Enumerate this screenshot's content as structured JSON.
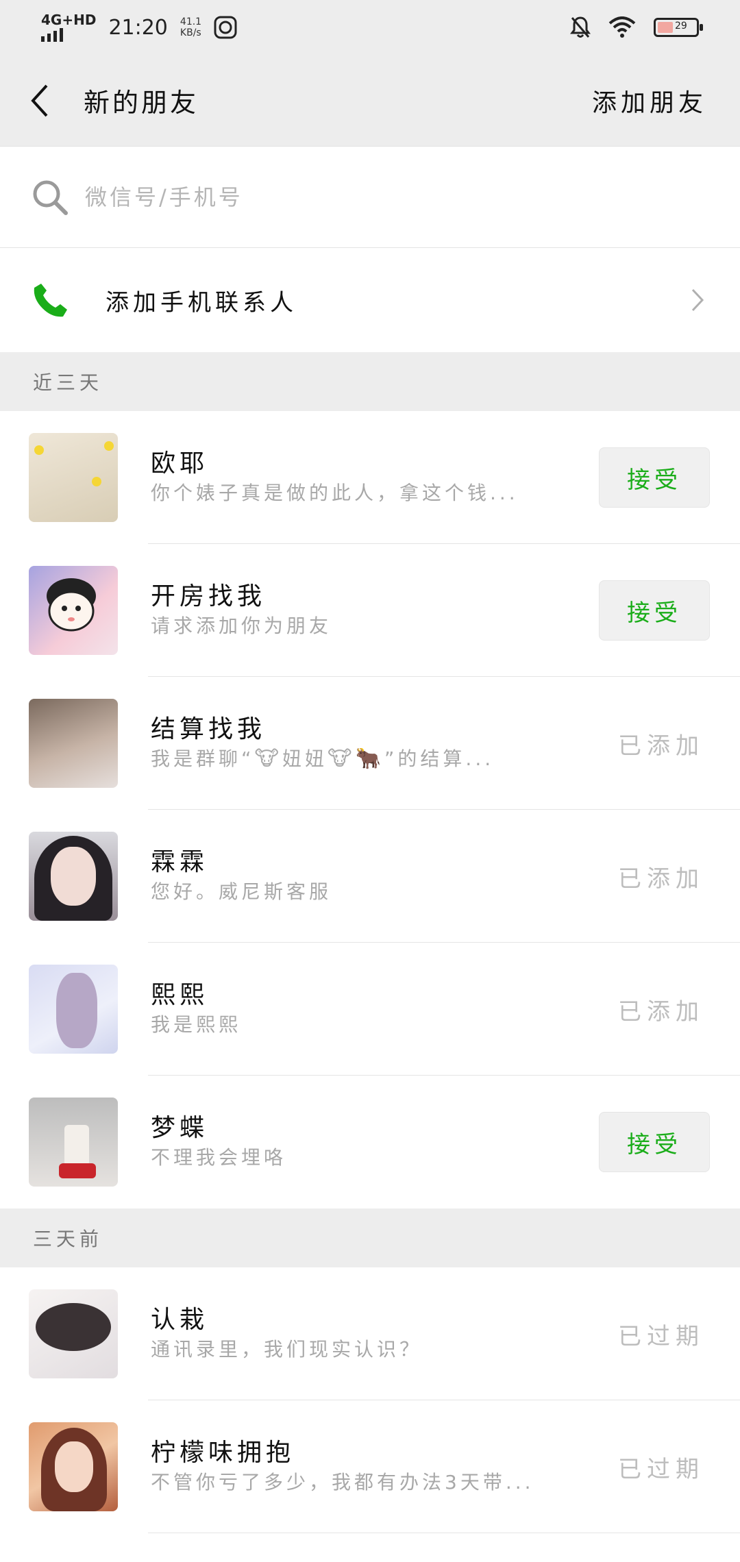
{
  "status_bar": {
    "network": "4G+HD",
    "time": "21:20",
    "speed_value": "41.1",
    "speed_unit": "KB/s",
    "battery": "29"
  },
  "header": {
    "title": "新的朋友",
    "action": "添加朋友"
  },
  "search": {
    "placeholder": "微信号/手机号"
  },
  "add_phone_contacts": {
    "label": "添加手机联系人"
  },
  "sections": [
    {
      "title": "近三天",
      "items": [
        {
          "name": "欧耶",
          "message": "你个婊子真是做的此人，拿这个钱...",
          "action": "接受"
        },
        {
          "name": "开房找我",
          "message": "请求添加你为朋友",
          "action": "接受"
        },
        {
          "name": "结算找我",
          "message_prefix": "我是群聊“",
          "message_mid": "妞妞",
          "message_suffix": "”的结算...",
          "status": "已添加"
        },
        {
          "name": "霖霖",
          "message": "您好。威尼斯客服",
          "status": "已添加"
        },
        {
          "name": "熙熙",
          "message": "我是熙熙",
          "status": "已添加"
        },
        {
          "name": "梦蝶",
          "message": "不理我会埋咯",
          "action": "接受"
        }
      ]
    },
    {
      "title": "三天前",
      "items": [
        {
          "name": "认栽",
          "message": "通讯录里，我们现实认识？",
          "status": "已过期"
        },
        {
          "name": "柠檬味拥抱",
          "message": "不管你亏了多少，我都有办法3天带...",
          "status": "已过期"
        }
      ]
    }
  ]
}
